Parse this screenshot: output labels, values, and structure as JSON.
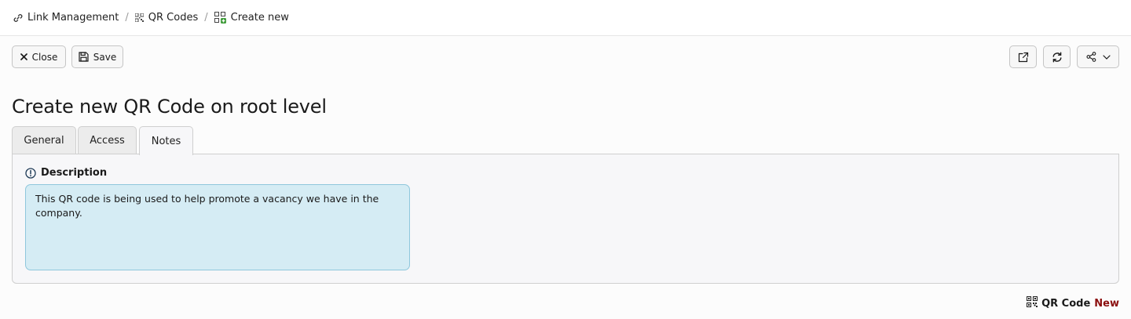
{
  "breadcrumb": {
    "items": [
      {
        "label": "Link Management",
        "icon": "link-icon"
      },
      {
        "label": "QR Codes",
        "icon": "qr-code-icon"
      },
      {
        "label": "Create new",
        "icon": "qr-code-add-icon"
      }
    ],
    "separator": "/"
  },
  "toolbar": {
    "close_label": "Close",
    "save_label": "Save",
    "right_icons": [
      "open-external-icon",
      "reload-icon",
      "share-icon"
    ]
  },
  "page": {
    "title": "Create new QR Code on root level"
  },
  "tabs": [
    {
      "label": "General",
      "active": false
    },
    {
      "label": "Access",
      "active": false
    },
    {
      "label": "Notes",
      "active": true
    }
  ],
  "notes": {
    "label": "Description",
    "label_icon": "info-circle-icon",
    "value": "This QR code is being used to help promote a vacancy we have in the company."
  },
  "status": {
    "type_label": "QR Code",
    "state_label": "New",
    "icon": "qr-code-icon"
  },
  "colors": {
    "accent_field_bg": "#d5ecf4",
    "accent_field_border": "#8fc7dc",
    "status_new": "#8b0e0e",
    "breadcrumb_add_icon": "#3e9b3a"
  }
}
